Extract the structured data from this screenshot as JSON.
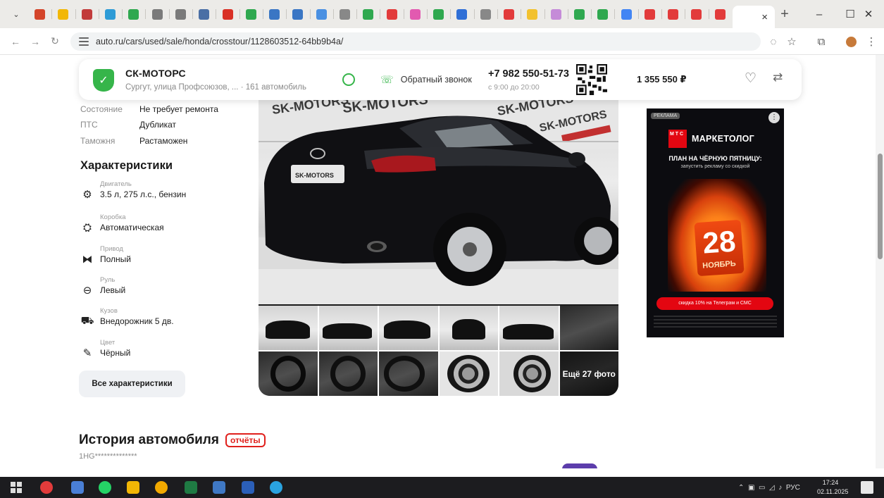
{
  "browser": {
    "tab_close_icon": "×",
    "new_tab_icon": "+",
    "tab_favicon_colors": [
      "#d4452a",
      "#f2b705",
      "#c23b3b",
      "#2e9bd6",
      "#2fa84f",
      "#7a7a7a",
      "#7a7a7a",
      "#4a6fa5",
      "#d93025",
      "#2fa84f",
      "#3a76c4",
      "#3a76c4",
      "#4a90e2",
      "#888888",
      "#2fa84f",
      "#e23b3b",
      "#e25ab0",
      "#2fa84f",
      "#2f6fd6",
      "#888888",
      "#e23b3b",
      "#f2c12e",
      "#c58bd8",
      "#2fa84f",
      "#2fa84f",
      "#4285f4",
      "#e23b3b",
      "#e23b3b",
      "#e23b3b",
      "#e23b3b"
    ],
    "url": "auto.ru/cars/used/sale/honda/crosstour/1128603512-64bb9b4a/",
    "window_controls": [
      "–",
      "☐",
      "✕"
    ]
  },
  "dealer": {
    "name": "СК-МОТОРС",
    "address": "Сургут, улица Профсоюзов, ...",
    "count": "161 автомобиль",
    "callback_label": "Обратный звонок",
    "phone": "+7 982 550-51-73",
    "hours": "с 9:00 до 20:00",
    "price": "1 355 550 ₽"
  },
  "details": [
    {
      "key": "Состояние",
      "value": "Не требует ремонта"
    },
    {
      "key": "ПТС",
      "value": "Дубликат"
    },
    {
      "key": "Таможня",
      "value": "Растаможен"
    }
  ],
  "characteristics": {
    "title": "Характеристики",
    "items": [
      {
        "label": "Двигатель",
        "value": "3.5 л, 275 л.с., бензин",
        "icon": "engine-icon"
      },
      {
        "label": "Коробка",
        "value": "Автоматическая",
        "icon": "gearbox-icon"
      },
      {
        "label": "Привод",
        "value": "Полный",
        "icon": "drive-icon"
      },
      {
        "label": "Руль",
        "value": "Левый",
        "icon": "steering-wheel-icon"
      },
      {
        "label": "Кузов",
        "value": "Внедорожник 5 дв.",
        "icon": "car-body-icon"
      },
      {
        "label": "Цвет",
        "value": "Чёрный",
        "icon": "paint-icon"
      }
    ],
    "all_button": "Все характеристики"
  },
  "gallery": {
    "watermark": "SK-MOTORS",
    "more_photos": "Ещё 27 фото"
  },
  "ad": {
    "tag": "РЕКЛАМА",
    "logo_text": "М Т С",
    "brand": "МАРКЕТОЛОГ",
    "headline": "ПЛАН НА ЧЁРНУЮ ПЯТНИЦУ:",
    "subline": "запустить рекламу со скидкой",
    "day": "28",
    "month": "НОЯБРЬ",
    "cta": "скидка 10% на Телеграм и СМС"
  },
  "history": {
    "title": "История автомобиля",
    "badge": "отчёты",
    "vin": "1HG**************"
  },
  "taskbar": {
    "language": "РУС",
    "time": "17:24",
    "date": "02.11.2025"
  }
}
